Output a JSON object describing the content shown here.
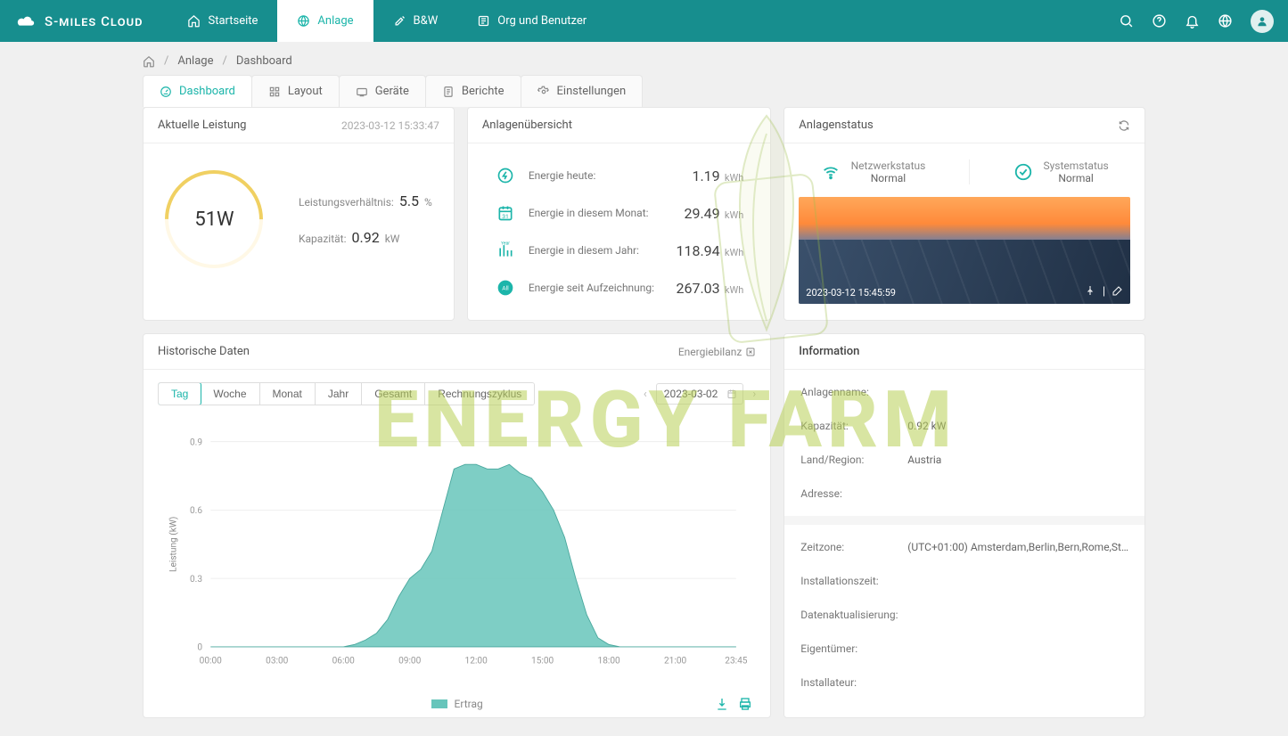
{
  "brand": "S-miles Cloud",
  "nav": [
    {
      "label": "Startseite"
    },
    {
      "label": "Anlage"
    },
    {
      "label": "B&W"
    },
    {
      "label": "Org und Benutzer"
    }
  ],
  "breadcrumb": {
    "a": "Anlage",
    "b": "Dashboard"
  },
  "tabs": [
    {
      "label": "Dashboard"
    },
    {
      "label": "Layout"
    },
    {
      "label": "Geräte"
    },
    {
      "label": "Berichte"
    },
    {
      "label": "Einstellungen"
    }
  ],
  "current": {
    "title": "Aktuelle Leistung",
    "timestamp": "2023-03-12 15:33:47",
    "power": "51W",
    "ratio_label": "Leistungsverhältnis:",
    "ratio_value": "5.5",
    "ratio_unit": "%",
    "capacity_label": "Kapazität:",
    "capacity_value": "0.92",
    "capacity_unit": "kW"
  },
  "overview": {
    "title": "Anlagenübersicht",
    "rows": [
      {
        "label": "Energie heute:",
        "value": "1.19",
        "unit": "kWh"
      },
      {
        "label": "Energie in diesem Monat:",
        "value": "29.49",
        "unit": "kWh"
      },
      {
        "label": "Energie in diesem Jahr:",
        "value": "118.94",
        "unit": "kWh"
      },
      {
        "label": "Energie seit Aufzeichnung:",
        "value": "267.03",
        "unit": "kWh"
      }
    ]
  },
  "status": {
    "title": "Anlagenstatus",
    "net_label": "Netzwerkstatus",
    "net_value": "Normal",
    "sys_label": "Systemstatus",
    "sys_value": "Normal",
    "image_timestamp": "2023-03-12 15:45:59"
  },
  "history": {
    "title": "Historische Daten",
    "balance": "Energiebilanz",
    "ranges": [
      "Tag",
      "Woche",
      "Monat",
      "Jahr",
      "Gesamt",
      "Rechnungszyklus"
    ],
    "date": "2023-03-02",
    "ylabel": "Leistung  (kW)",
    "legend": "Ertrag"
  },
  "chart_data": {
    "type": "area",
    "title": "",
    "xlabel": "",
    "ylabel": "Leistung  (kW)",
    "ylim": [
      0,
      0.9
    ],
    "x_ticks": [
      "00:00",
      "03:00",
      "06:00",
      "09:00",
      "12:00",
      "15:00",
      "18:00",
      "21:00",
      "23:45"
    ],
    "x": [
      "00:00",
      "03:00",
      "06:00",
      "06:30",
      "07:00",
      "07:30",
      "08:00",
      "08:30",
      "09:00",
      "09:30",
      "10:00",
      "10:30",
      "11:00",
      "11:30",
      "12:00",
      "12:30",
      "13:00",
      "13:30",
      "14:00",
      "14:30",
      "15:00",
      "15:30",
      "16:00",
      "16:30",
      "17:00",
      "17:30",
      "18:00",
      "18:30",
      "21:00",
      "23:45"
    ],
    "series": [
      {
        "name": "Ertrag",
        "values": [
          0,
          0,
          0,
          0.01,
          0.03,
          0.06,
          0.12,
          0.22,
          0.3,
          0.34,
          0.42,
          0.6,
          0.78,
          0.8,
          0.8,
          0.78,
          0.78,
          0.8,
          0.76,
          0.74,
          0.68,
          0.6,
          0.48,
          0.3,
          0.14,
          0.04,
          0.01,
          0,
          0,
          0
        ]
      }
    ]
  },
  "info": {
    "title": "Information",
    "rows1": [
      {
        "label": "Anlagenname:",
        "value": ""
      },
      {
        "label": "Kapazität:",
        "value": "0.92 kW"
      },
      {
        "label": "Land/Region:",
        "value": "Austria"
      },
      {
        "label": "Adresse:",
        "value": ""
      }
    ],
    "rows2": [
      {
        "label": "Zeitzone:",
        "value": "(UTC+01:00) Amsterdam,Berlin,Bern,Rome,St…"
      },
      {
        "label": "Installationszeit:",
        "value": ""
      },
      {
        "label": "Datenaktualisierung:",
        "value": ""
      },
      {
        "label": "Eigentümer:",
        "value": ""
      },
      {
        "label": "Installateur:",
        "value": ""
      }
    ]
  },
  "watermark": "ENERGY FARM"
}
